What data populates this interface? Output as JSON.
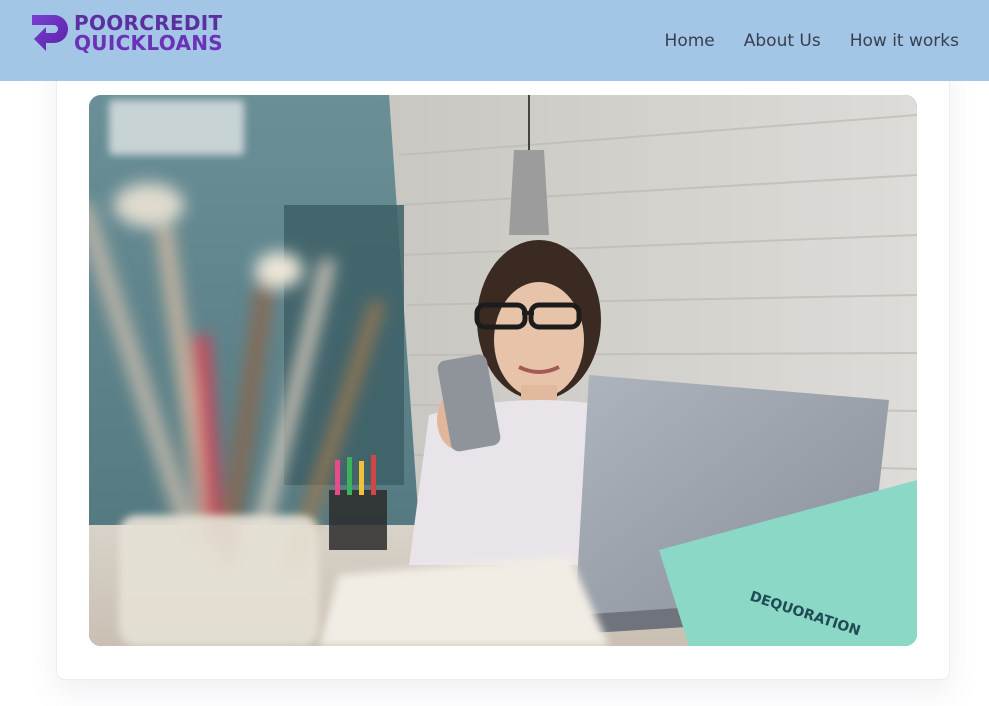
{
  "logo": {
    "line1": "POORCREDIT",
    "line2": "QUICKLOANS",
    "mark_icon": "arrow-p-logo-icon",
    "brand_color": "#5b2fa0"
  },
  "nav": {
    "items": [
      "Home",
      "About Us",
      "How it works"
    ]
  },
  "header": {
    "background": "#a3c5e6"
  },
  "hero_image": {
    "subject": "woman-with-phone-and-laptop-photo",
    "notebook_text": "DEQUORATION"
  }
}
